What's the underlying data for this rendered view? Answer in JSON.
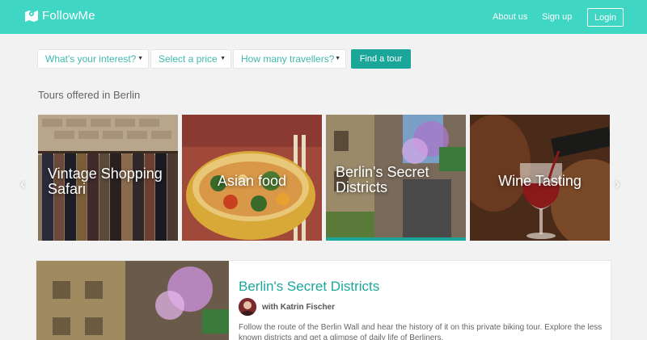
{
  "brand": {
    "name": "FollowMe",
    "logo_icon": "map-pin-icon",
    "color": "#40d6c4"
  },
  "nav": {
    "about": "About us",
    "signup": "Sign up",
    "login": "Login"
  },
  "search": {
    "interest": "What's your interest?",
    "price": "Select a price",
    "travellers": "How many travellers?",
    "submit": "Find a tour"
  },
  "section_title": "Tours offered in Berlin",
  "tours": [
    {
      "title": "Vintage Shopping Safari"
    },
    {
      "title": "Asian food"
    },
    {
      "title": "Berlin's Secret Districts"
    },
    {
      "title": "Wine Tasting"
    }
  ],
  "detail": {
    "title": "Berlin's Secret Districts",
    "guide": "with Katrin Fischer",
    "description": "Follow the route of the Berlin Wall and hear the history of it on this private biking tour. Explore the less known districts and get a glimpse of daily life of Berliners."
  },
  "colors": {
    "accent": "#1aa79a",
    "header": "#40d6c4",
    "link_text": "#3fb8ad"
  }
}
